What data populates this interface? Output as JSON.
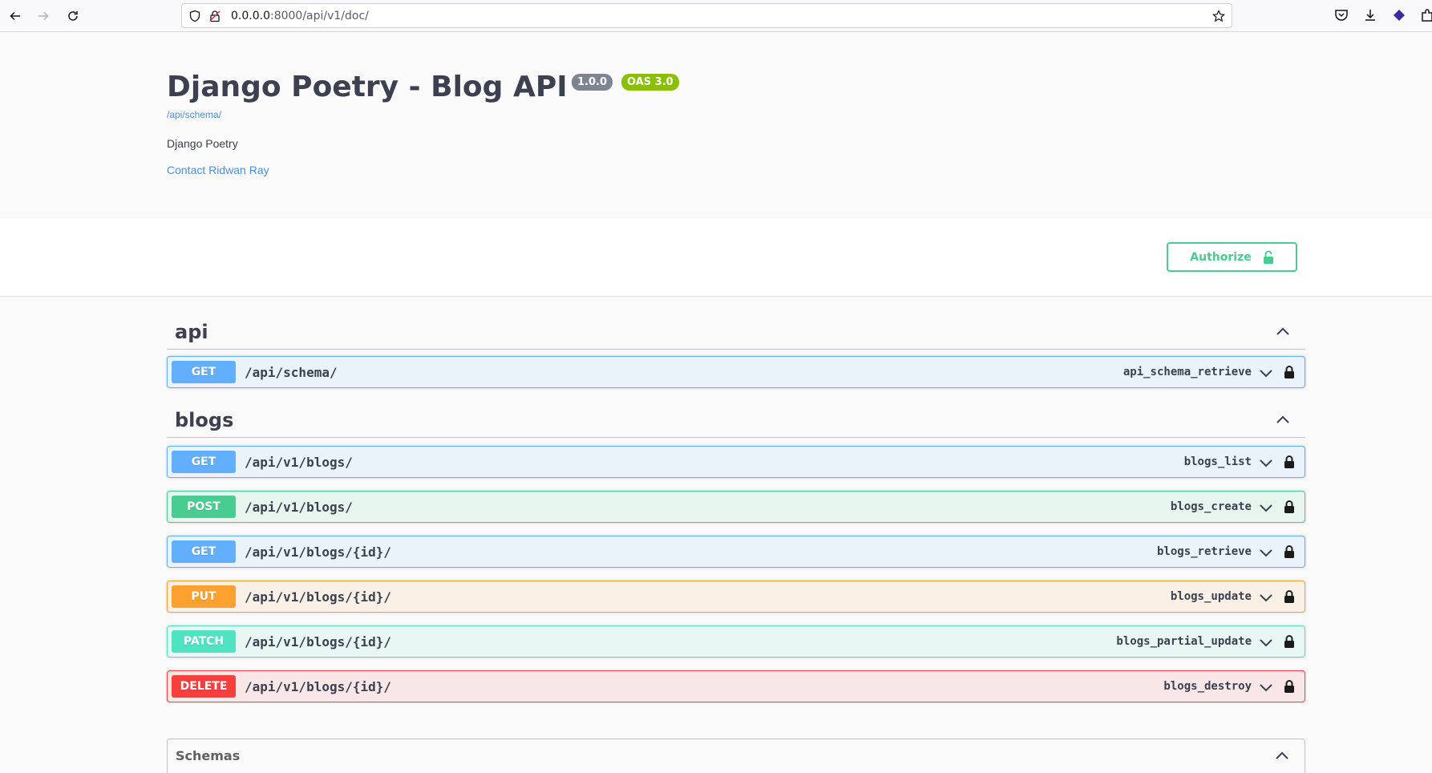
{
  "browser": {
    "url_host": "0.0.0.0",
    "url_rest": ":8000/api/v1/doc/"
  },
  "info": {
    "title": "Django Poetry - Blog API",
    "version": "1.0.0",
    "oas": "OAS 3.0",
    "schema_link": "/api/schema/",
    "description": "Django Poetry",
    "contact": "Contact Ridwan Ray"
  },
  "authorize": {
    "label": "Authorize"
  },
  "tags": [
    {
      "name": "api",
      "operations": [
        {
          "method": "GET",
          "path": "/api/schema/",
          "operation_id": "api_schema_retrieve"
        }
      ]
    },
    {
      "name": "blogs",
      "operations": [
        {
          "method": "GET",
          "path": "/api/v1/blogs/",
          "operation_id": "blogs_list"
        },
        {
          "method": "POST",
          "path": "/api/v1/blogs/",
          "operation_id": "blogs_create"
        },
        {
          "method": "GET",
          "path": "/api/v1/blogs/{id}/",
          "operation_id": "blogs_retrieve"
        },
        {
          "method": "PUT",
          "path": "/api/v1/blogs/{id}/",
          "operation_id": "blogs_update"
        },
        {
          "method": "PATCH",
          "path": "/api/v1/blogs/{id}/",
          "operation_id": "blogs_partial_update"
        },
        {
          "method": "DELETE",
          "path": "/api/v1/blogs/{id}/",
          "operation_id": "blogs_destroy"
        }
      ]
    }
  ],
  "schemas": {
    "title": "Schemas"
  },
  "colors": {
    "get": "#61affe",
    "post": "#49cc90",
    "put": "#fca130",
    "patch": "#50e3c2",
    "delete": "#f93e3e",
    "link": "#4990e2",
    "version_badge": "#7d8492",
    "oas_badge": "#89bf04"
  }
}
